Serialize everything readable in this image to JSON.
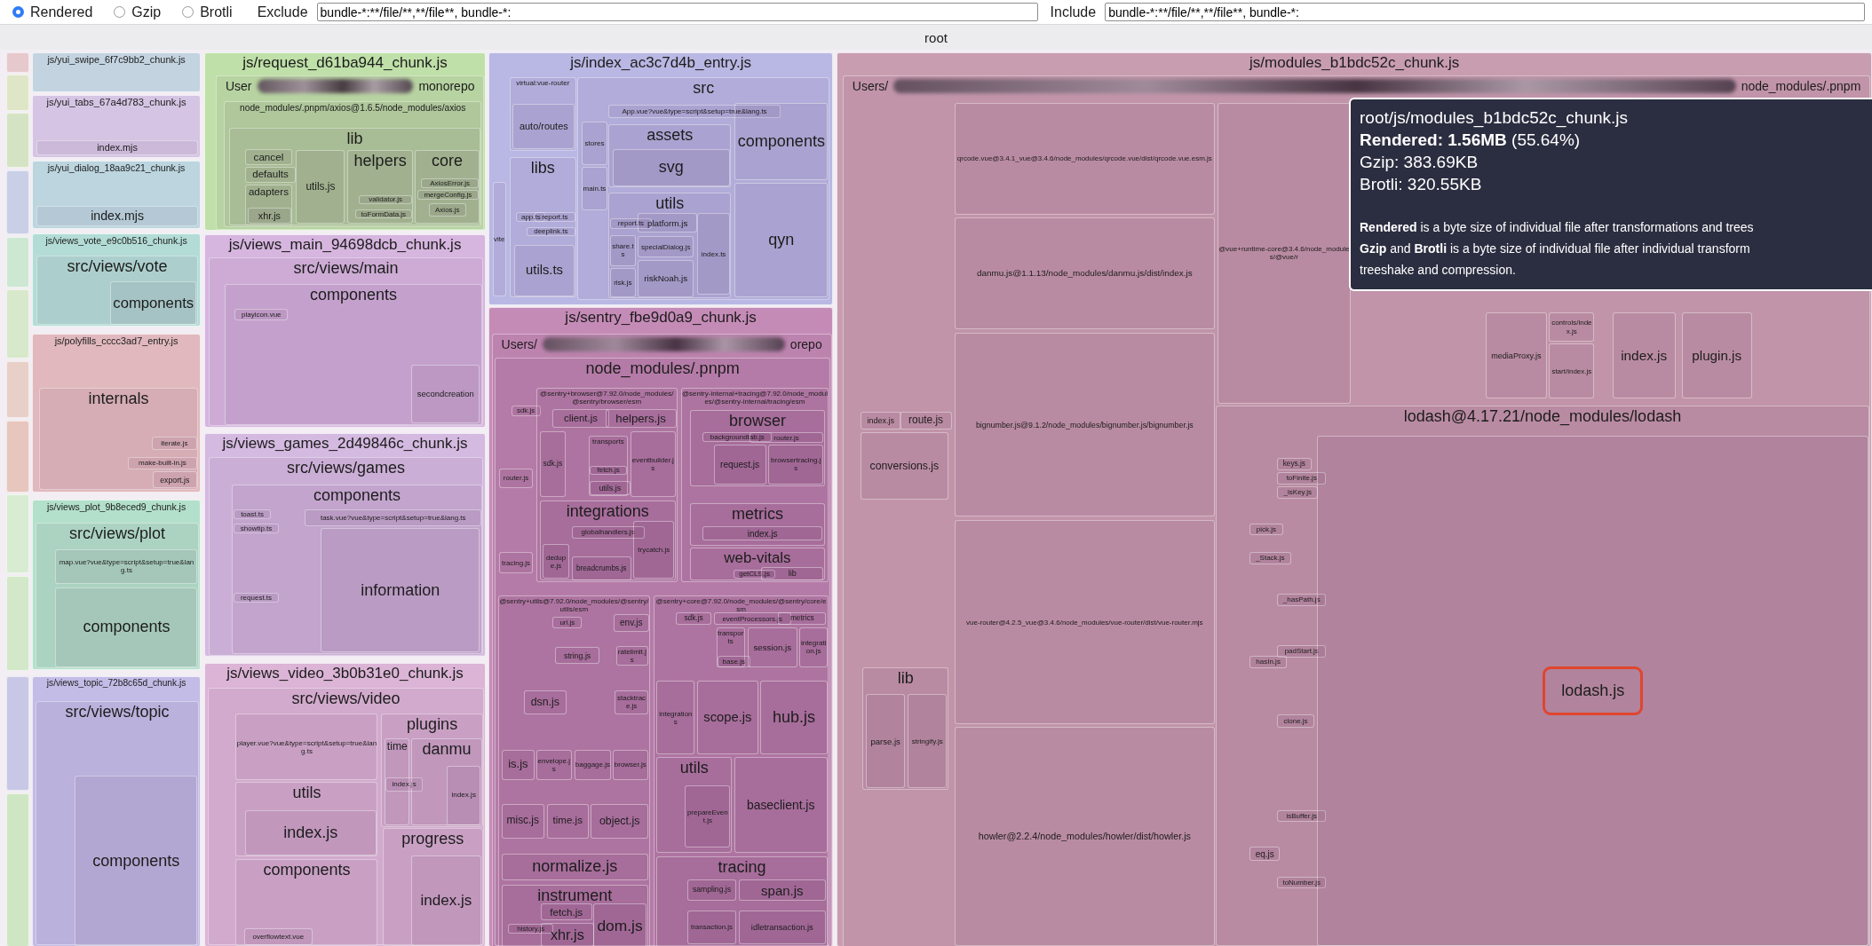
{
  "toolbar": {
    "modes": [
      {
        "label": "Rendered",
        "selected": true
      },
      {
        "label": "Gzip",
        "selected": false
      },
      {
        "label": "Brotli",
        "selected": false
      }
    ],
    "exclude": {
      "label": "Exclude",
      "value": "bundle-*:**/file/**,**/file**, bundle-*:"
    },
    "include": {
      "label": "Include",
      "value": "bundle-*:**/file/**,**/file**, bundle-*:"
    }
  },
  "treemap": {
    "root": "root",
    "chunks": [
      {
        "label": "js/yui_swipe_6f7c9bb2_chunk.js",
        "color": "#c3d3e0"
      },
      {
        "label": "js/yui_tabs_67a4d783_chunk.js",
        "color": "#d5c4e3",
        "children": [
          {
            "label": "index.mjs"
          }
        ]
      },
      {
        "label": "js/yui_dialog_18aa9c21_chunk.js",
        "color": "#bcd5df",
        "children": [
          {
            "label": "index.mjs"
          }
        ]
      },
      {
        "label": "js/views_vote_e9c0b516_chunk.js",
        "color": "#b3dcd6",
        "children": [
          {
            "label": "src/views/vote",
            "children": [
              {
                "label": "components"
              }
            ]
          }
        ]
      },
      {
        "label": "js/polyfills_cccc3ad7_entry.js",
        "color": "#e0b8bd",
        "children": [
          {
            "label": "internals",
            "children": [
              {
                "label": "iterate.js"
              },
              {
                "label": "make-built-in.js"
              },
              {
                "label": "export.js"
              }
            ]
          }
        ]
      },
      {
        "label": "js/views_plot_9b8eced9_chunk.js",
        "color": "#b3e0cb",
        "children": [
          {
            "label": "src/views/plot",
            "children": [
              {
                "label": "map.vue?vue&type=script&setup=true&lang.ts"
              },
              {
                "label": "components"
              }
            ]
          }
        ]
      },
      {
        "label": "js/views_topic_72b8c65d_chunk.js",
        "color": "#c2bce6",
        "children": [
          {
            "label": "src/views/topic",
            "children": [
              {
                "label": "components"
              }
            ]
          }
        ]
      },
      {
        "label": "js/request_d61ba944_chunk.js",
        "color": "#bfe0a8",
        "children": [
          {
            "label": "User",
            "label_end": "monorepo",
            "children": [
              {
                "label": "node_modules/.pnpm/axios@1.6.5/node_modules/axios",
                "children": [
                  {
                    "label": "lib",
                    "children": [
                      {
                        "label": "cancel"
                      },
                      {
                        "label": "defaults"
                      },
                      {
                        "label": "adapters",
                        "children": [
                          {
                            "label": "xhr.js"
                          }
                        ]
                      },
                      {
                        "label": "utils.js"
                      },
                      {
                        "label": "helpers",
                        "children": [
                          {
                            "label": "validator.js"
                          },
                          {
                            "label": "toFormData.js"
                          }
                        ]
                      },
                      {
                        "label": "core",
                        "children": [
                          {
                            "label": "AxiosError.js"
                          },
                          {
                            "label": "mergeConfig.js"
                          },
                          {
                            "label": "Axios.js"
                          }
                        ]
                      }
                    ]
                  }
                ]
              }
            ]
          }
        ]
      },
      {
        "label": "js/views_main_94698dcb_chunk.js",
        "color": "#d6b5df",
        "children": [
          {
            "label": "src/views/main",
            "children": [
              {
                "label": "components",
                "children": [
                  {
                    "label": "playicon.vue"
                  },
                  {
                    "label": "secondcreation"
                  }
                ]
              }
            ]
          }
        ]
      },
      {
        "label": "js/views_games_2d49846c_chunk.js",
        "color": "#d4b9e0",
        "children": [
          {
            "label": "src/views/games",
            "children": [
              {
                "label": "components",
                "children": [
                  {
                    "label": "toast.ts"
                  },
                  {
                    "label": "showtip.ts"
                  },
                  {
                    "label": "request.ts"
                  },
                  {
                    "label": "task.vue?vue&type=script&setup=true&lang.ts"
                  },
                  {
                    "label": "information"
                  }
                ]
              }
            ]
          }
        ]
      },
      {
        "label": "js/views_video_3b0b31e0_chunk.js",
        "color": "#dbb4d6",
        "children": [
          {
            "label": "src/views/video",
            "children": [
              {
                "label": "player.vue?vue&type=script&setup=true&lang.ts"
              },
              {
                "label": "utils",
                "children": [
                  {
                    "label": "index.js"
                  }
                ]
              },
              {
                "label": "components",
                "children": [
                  {
                    "label": "overflowtext.vue"
                  }
                ]
              },
              {
                "label": "plugins",
                "children": [
                  {
                    "label": "time",
                    "children": [
                      {
                        "label": "index.js"
                      }
                    ]
                  },
                  {
                    "label": "danmu",
                    "children": [
                      {
                        "label": "index.js"
                      }
                    ]
                  }
                ]
              },
              {
                "label": "progress",
                "children": [
                  {
                    "label": "index.js"
                  }
                ]
              }
            ]
          }
        ]
      },
      {
        "label": "js/index_ac3c7d4b_entry.js",
        "color": "#b9b7e3",
        "children": [
          {
            "label": "virtual:vue-router",
            "children": [
              {
                "label": "auto/routes"
              }
            ]
          },
          {
            "label": "vite"
          },
          {
            "label": "libs",
            "children": [
              {
                "label": "app.ts"
              },
              {
                "label": "report.ts"
              },
              {
                "label": "deeplink.ts"
              },
              {
                "label": "utils.ts"
              }
            ]
          },
          {
            "label": "src",
            "children": [
              {
                "label": "stores"
              },
              {
                "label": "main.ts"
              },
              {
                "label": "App.vue?vue&type=script&setup=true&lang.ts"
              },
              {
                "label": "assets",
                "children": [
                  {
                    "label": "svg"
                  }
                ]
              },
              {
                "label": "utils",
                "children": [
                  {
                    "label": "report.ts"
                  },
                  {
                    "label": "platform.js"
                  },
                  {
                    "label": "share.ts"
                  },
                  {
                    "label": "specialDialog.js"
                  },
                  {
                    "label": "index.ts"
                  },
                  {
                    "label": "risk.js"
                  },
                  {
                    "label": "riskNoah.js"
                  }
                ]
              },
              {
                "label": "components"
              },
              {
                "label": "qyn"
              }
            ]
          }
        ]
      },
      {
        "label": "js/sentry_fbe9d0a9_chunk.js",
        "color": "#c58bb7",
        "children": [
          {
            "label": "Users/",
            "label_end": "orepo",
            "children": [
              {
                "label": "node_modules/.pnpm",
                "children": [
                  {
                    "label": "sdk.js"
                  },
                  {
                    "label": "router.js"
                  },
                  {
                    "label": "tracing.js"
                  },
                  {
                    "label": "@sentry+browser@7.92.0/node_modules/@sentry/browser/esm",
                    "children": [
                      {
                        "label": "client.js"
                      },
                      {
                        "label": "helpers.js"
                      },
                      {
                        "label": "sdk.js"
                      },
                      {
                        "label": "transports",
                        "children": [
                          {
                            "label": "fetch.js"
                          },
                          {
                            "label": "utils.js"
                          }
                        ]
                      },
                      {
                        "label": "eventbuilder.js"
                      },
                      {
                        "label": "integrations",
                        "children": [
                          {
                            "label": "globalhandlers.js"
                          },
                          {
                            "label": "dedupe.js"
                          },
                          {
                            "label": "breadcrumbs.js"
                          },
                          {
                            "label": "trycatch.js"
                          }
                        ]
                      }
                    ]
                  },
                  {
                    "label": "@sentry-internal+tracing@7.92.0/node_modules/@sentry-internal/tracing/esm",
                    "children": [
                      {
                        "label": "browser",
                        "children": [
                          {
                            "label": "backgroundtab.js"
                          },
                          {
                            "label": "router.js"
                          },
                          {
                            "label": "request.js"
                          },
                          {
                            "label": "browsertracing.js"
                          }
                        ]
                      },
                      {
                        "label": "metrics",
                        "children": [
                          {
                            "label": "index.js"
                          }
                        ]
                      },
                      {
                        "label": "web-vitals",
                        "children": [
                          {
                            "label": "getCLS.js"
                          },
                          {
                            "label": "lib"
                          }
                        ]
                      }
                    ]
                  },
                  {
                    "label": "@sentry+utils@7.92.0/node_modules/@sentry/utils/esm",
                    "children": [
                      {
                        "label": "url.js"
                      },
                      {
                        "label": "env.js"
                      },
                      {
                        "label": "string.js"
                      },
                      {
                        "label": "ratelimit.js"
                      },
                      {
                        "label": "dsn.js"
                      },
                      {
                        "label": "stacktrace.js"
                      },
                      {
                        "label": "is.js"
                      },
                      {
                        "label": "envelope.js"
                      },
                      {
                        "label": "baggage.js"
                      },
                      {
                        "label": "browser.js"
                      },
                      {
                        "label": "misc.js"
                      },
                      {
                        "label": "time.js"
                      },
                      {
                        "label": "object.js"
                      },
                      {
                        "label": "normalize.js"
                      },
                      {
                        "label": "instrument",
                        "children": [
                          {
                            "label": "history.js"
                          },
                          {
                            "label": "fetch.js"
                          },
                          {
                            "label": "xhr.js"
                          },
                          {
                            "label": "dom.js"
                          }
                        ]
                      }
                    ]
                  },
                  {
                    "label": "@sentry+core@7.92.0/node_modules/@sentry/core/esm",
                    "children": [
                      {
                        "label": "sdk.js"
                      },
                      {
                        "label": "eventProcessors.js"
                      },
                      {
                        "label": "metrics"
                      },
                      {
                        "label": "transports",
                        "children": [
                          {
                            "label": "base.js"
                          }
                        ]
                      },
                      {
                        "label": "session.js"
                      },
                      {
                        "label": "integration.js"
                      },
                      {
                        "label": "integrations"
                      },
                      {
                        "label": "scope.js"
                      },
                      {
                        "label": "hub.js"
                      },
                      {
                        "label": "utils",
                        "children": [
                          {
                            "label": "prepareEvent.js"
                          }
                        ]
                      },
                      {
                        "label": "baseclient.js"
                      },
                      {
                        "label": "tracing",
                        "children": [
                          {
                            "label": "sampling.js"
                          },
                          {
                            "label": "span.js"
                          },
                          {
                            "label": "transaction.js"
                          },
                          {
                            "label": "idletransaction.js"
                          }
                        ]
                      }
                    ]
                  }
                ]
              }
            ]
          }
        ]
      },
      {
        "label": "js/modules_b1bdc52c_chunk.js",
        "color": "#c99db0",
        "children": [
          {
            "label": "Users/",
            "label_end": "node_modules/.pnpm",
            "children": [
              {
                "label": "index.js"
              },
              {
                "label": "route.js"
              },
              {
                "label": "conversions.js"
              },
              {
                "label": "lib",
                "children": [
                  {
                    "label": "parse.js"
                  },
                  {
                    "label": "stringify.js"
                  }
                ]
              },
              {
                "label": "qrcode.vue@3.4.1_vue@3.4.6/node_modules/qrcode.vue/dist/qrcode.vue.esm.js"
              },
              {
                "label": "danmu.js@1.1.13/node_modules/danmu.js/dist/index.js"
              },
              {
                "label": "bignumber.js@9.1.2/node_modules/bignumber.js/bignumber.js"
              },
              {
                "label": "vue-router@4.2.5_vue@3.4.6/node_modules/vue-router/dist/vue-router.mjs"
              },
              {
                "label": "howler@2.2.4/node_modules/howler/dist/howler.js"
              },
              {
                "label": "@vue+runtime-core@3.4.6/node_modules/@vue/r"
              },
              {
                "label": "mediaProxy.js"
              },
              {
                "label": "controls/index.js"
              },
              {
                "label": "start/index.js"
              },
              {
                "label": "index.js"
              },
              {
                "label": "plugin.js"
              },
              {
                "label": "lodash@4.17.21/node_modules/lodash",
                "children": [
                  {
                    "label": "keys.js",
                    "highlighted": false
                  },
                  {
                    "label": "toFinite.js",
                    "highlighted": false
                  },
                  {
                    "label": "_isKey.js",
                    "highlighted": false
                  },
                  {
                    "label": "pick.js",
                    "highlighted": false
                  },
                  {
                    "label": "_Stack.js",
                    "highlighted": false
                  },
                  {
                    "label": "_hasPath.js",
                    "highlighted": false
                  },
                  {
                    "label": "padStart.js",
                    "highlighted": false
                  },
                  {
                    "label": "hasIn.js",
                    "highlighted": false
                  },
                  {
                    "label": "clone.js",
                    "highlighted": false
                  },
                  {
                    "label": "isBuffer.js",
                    "highlighted": false
                  },
                  {
                    "label": "eq.js",
                    "highlighted": false
                  },
                  {
                    "label": "toNumber.js",
                    "highlighted": false
                  },
                  {
                    "label": "lodash.js",
                    "highlighted": true
                  }
                ]
              }
            ]
          }
        ]
      }
    ]
  },
  "tooltip": {
    "path": "root/js/modules_b1bdc52c_chunk.js",
    "rendered": "**Rendered: 1.56MB** (55.64%)",
    "gzip": "Gzip: 383.69KB",
    "brotli": "Brotli: 320.55KB",
    "notes": [
      "**Rendered** is a byte size of individual file after transformations and trees",
      "**Gzip** and **Brotli** is a byte size of individual file after individual transform",
      "treeshake and compression."
    ]
  }
}
